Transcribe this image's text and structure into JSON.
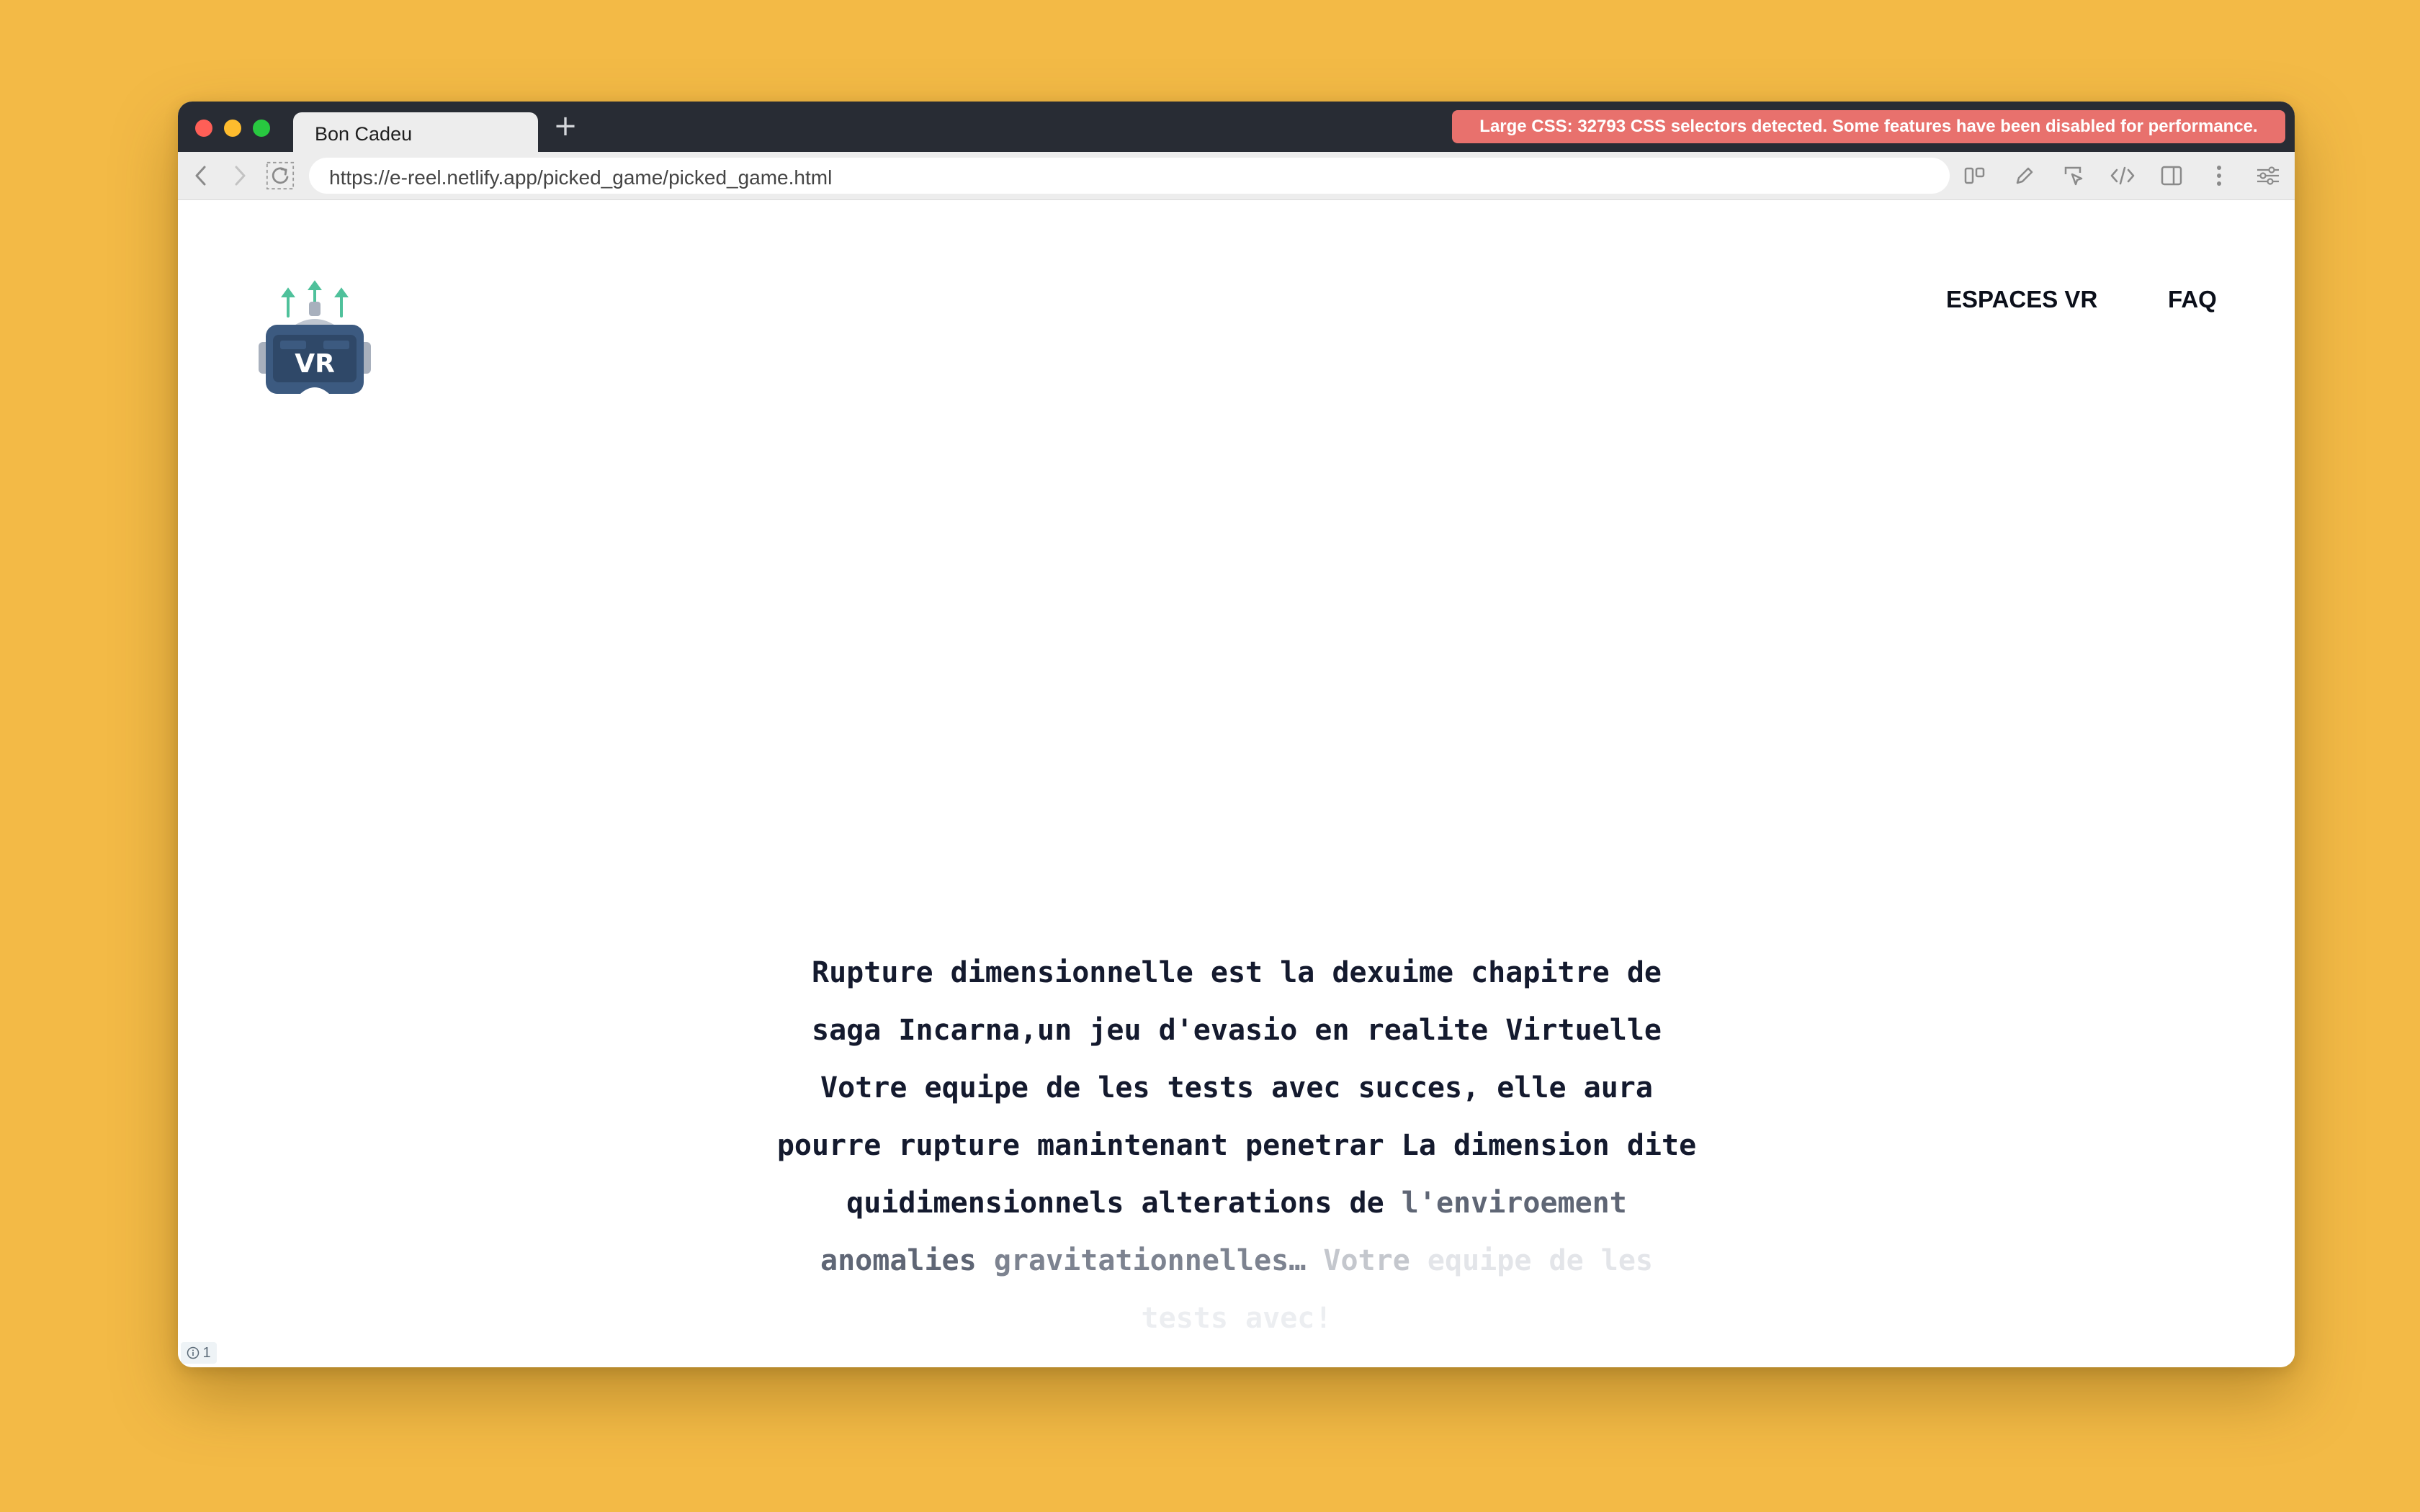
{
  "browser": {
    "tab_title": "Bon Cadeu",
    "new_tab_symbol": "+",
    "warning": "Large CSS: 32793 CSS selectors detected. Some features have been disabled for performance.",
    "url": "https://e-reel.netlify.app/picked_game/picked_game.html",
    "toolbar_icons": [
      "back-icon",
      "forward-icon",
      "reload-icon",
      "layout-icon",
      "pencil-icon",
      "inspect-cursor-icon",
      "code-icon",
      "sidebar-icon",
      "more-icon",
      "settings-sliders-icon"
    ]
  },
  "site": {
    "logo_text": "VR",
    "nav": [
      {
        "label": "ESPACES VR"
      },
      {
        "label": "FAQ"
      }
    ],
    "hero_lines": [
      "Rupture dimensionnelle est la dexuime chapitre de",
      "saga Incarna,un jeu d'evasio en realite Virtuelle",
      "Votre equipe de les tests avec succes, elle aura",
      "pourre rupture manintenant penetrar La dimension dite",
      "quidimensionnels alterations de",
      "l'enviroement",
      "anomalies",
      "gravitationnelles…",
      "Votre",
      "equipe de les",
      "tests avec!"
    ],
    "info_badge": "1"
  },
  "colors": {
    "background": "#F3BA46",
    "chrome": "#282c34",
    "warning": "#E8716D",
    "text": "#141a2e",
    "logo_body": "#3C5A80",
    "logo_arrows": "#4FC19B"
  }
}
